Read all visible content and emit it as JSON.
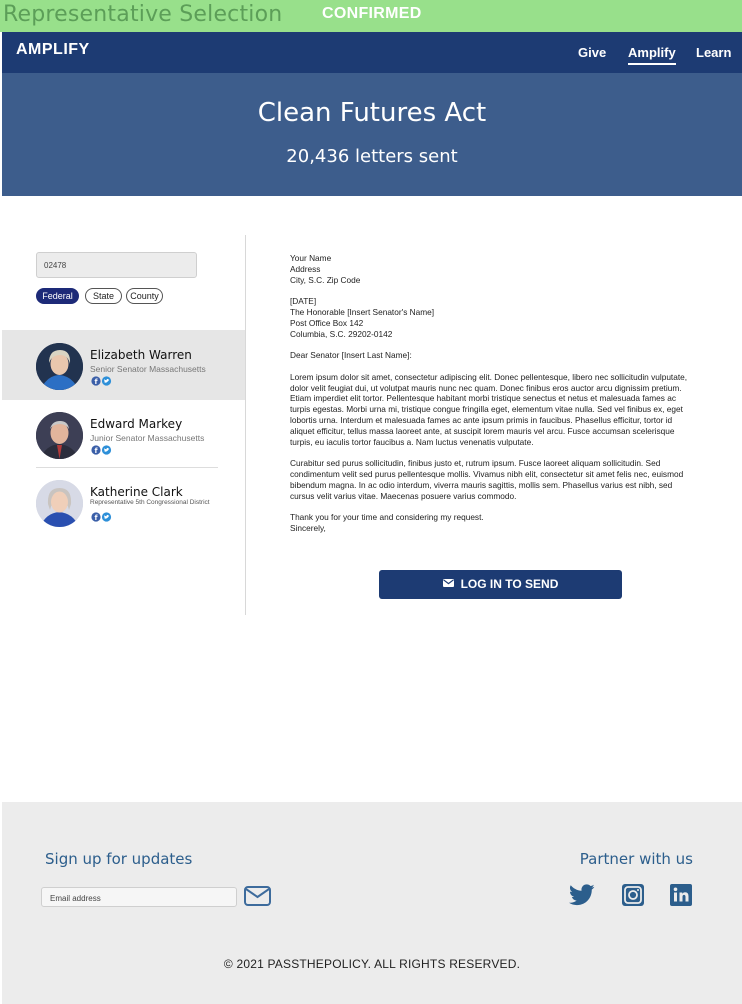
{
  "topbar": {
    "selection_label": "Representative Selection",
    "status": "CONFIRMED"
  },
  "nav": {
    "brand": "AMPLIFY",
    "links": [
      "Give",
      "Amplify",
      "Learn"
    ],
    "active": "Amplify"
  },
  "hero": {
    "title": "Clean Futures Act",
    "letters_sent": "20,436 letters sent"
  },
  "search": {
    "zip_value": "02478"
  },
  "filters": [
    "Federal",
    "State",
    "County"
  ],
  "active_filter": "Federal",
  "representatives": [
    {
      "name": "Elizabeth Warren",
      "role": "Senior Senator Massachusetts",
      "selected": true
    },
    {
      "name": "Edward Markey",
      "role": "Junior Senator Massachusetts",
      "selected": false
    },
    {
      "name": "Katherine Clark",
      "role": "Representative 5th Congressional District",
      "selected": false
    }
  ],
  "letter": {
    "sender_name": "Your Name",
    "sender_address": "Address",
    "sender_city": "City, S.C. Zip Code",
    "date": "[DATE]",
    "recipient_name": "The Honorable [Insert Senator's Name]",
    "recipient_box": "Post Office Box 142",
    "recipient_city": "Columbia, S.C. 29202-0142",
    "salutation": "Dear Senator [Insert Last Name]:",
    "paragraph1": "Lorem ipsum dolor sit amet, consectetur adipiscing elit. Donec pellentesque, libero nec sollicitudin vulputate, dolor velit feugiat dui, ut volutpat mauris nunc nec quam. Donec finibus eros auctor arcu dignissim pretium. Etiam imperdiet elit tortor. Pellentesque habitant morbi tristique senectus et netus et malesuada fames ac turpis egestas. Morbi urna mi, tristique congue fringilla eget, elementum vitae nulla. Sed vel finibus ex, eget lobortis urna. Interdum et malesuada fames ac ante ipsum primis in faucibus. Phasellus efficitur, tortor id aliquet efficitur, tellus massa laoreet ante, at suscipit lorem mauris vel arcu. Fusce accumsan scelerisque turpis, eu iaculis tortor faucibus a. Nam luctus venenatis vulputate.",
    "paragraph2": "Curabitur sed purus sollicitudin, finibus justo et, rutrum ipsum. Fusce laoreet aliquam sollicitudin. Sed condimentum velit sed purus pellentesque mollis. Vivamus nibh elit, consectetur sit amet felis nec, euismod bibendum magna. In ac odio interdum, viverra mauris sagittis, mollis sem. Phasellus varius est nibh, sed cursus velit varius vitae. Maecenas posuere varius commodo.",
    "closing": "Thank you for your time and considering my request.",
    "signoff": "Sincerely,"
  },
  "send_button": {
    "label": "LOG IN TO SEND",
    "icon": "mail-icon"
  },
  "footer": {
    "signup_title": "Sign up for updates",
    "email_placeholder": "Email address",
    "partner_title": "Partner with us",
    "social_icons": [
      "twitter-icon",
      "instagram-icon",
      "linkedin-icon"
    ],
    "copyright": "© 2021 PASSTHEPOLICY. ALL RIGHTS RESERVED."
  },
  "colors": {
    "nav": "#1d3b73",
    "hero": "#3d5d8c",
    "confirmed_bar": "#98e08b",
    "footer_text": "#2c5e8c",
    "filter_active": "#1d2a78"
  }
}
